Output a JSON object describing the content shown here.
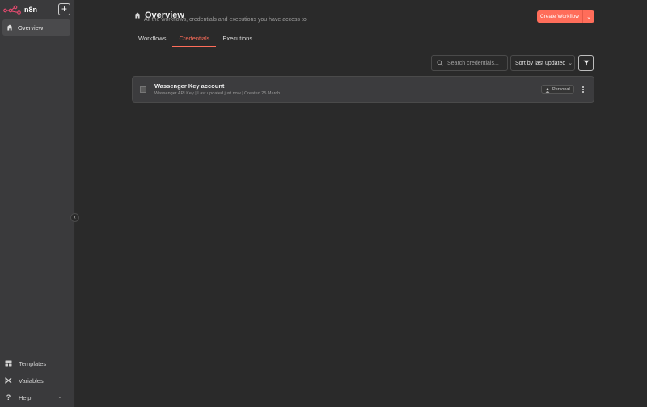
{
  "app": {
    "name": "n8n",
    "brand_color": "#ff6d5a"
  },
  "sidebar": {
    "add_label": "+",
    "items": [
      {
        "label": "Overview",
        "icon": "home-icon",
        "active": true
      }
    ],
    "bottom_items": [
      {
        "label": "Templates",
        "icon": "templates-icon"
      },
      {
        "label": "Variables",
        "icon": "variables-icon"
      },
      {
        "label": "Help",
        "icon": "help-icon"
      }
    ]
  },
  "header": {
    "title": "Overview",
    "subtitle": "All the workflows, credentials and executions you have access to",
    "create_button": "Create Workflow"
  },
  "tabs": [
    {
      "label": "Workflows",
      "active": false
    },
    {
      "label": "Credentials",
      "active": true
    },
    {
      "label": "Executions",
      "active": false
    }
  ],
  "toolbar": {
    "search_placeholder": "Search credentials...",
    "sort_value": "Sort by last updated"
  },
  "credentials": [
    {
      "name": "Wassenger Key account",
      "meta": "Wassenger API Key | Last updated just now | Created 25 March",
      "badge": "Personal"
    }
  ]
}
